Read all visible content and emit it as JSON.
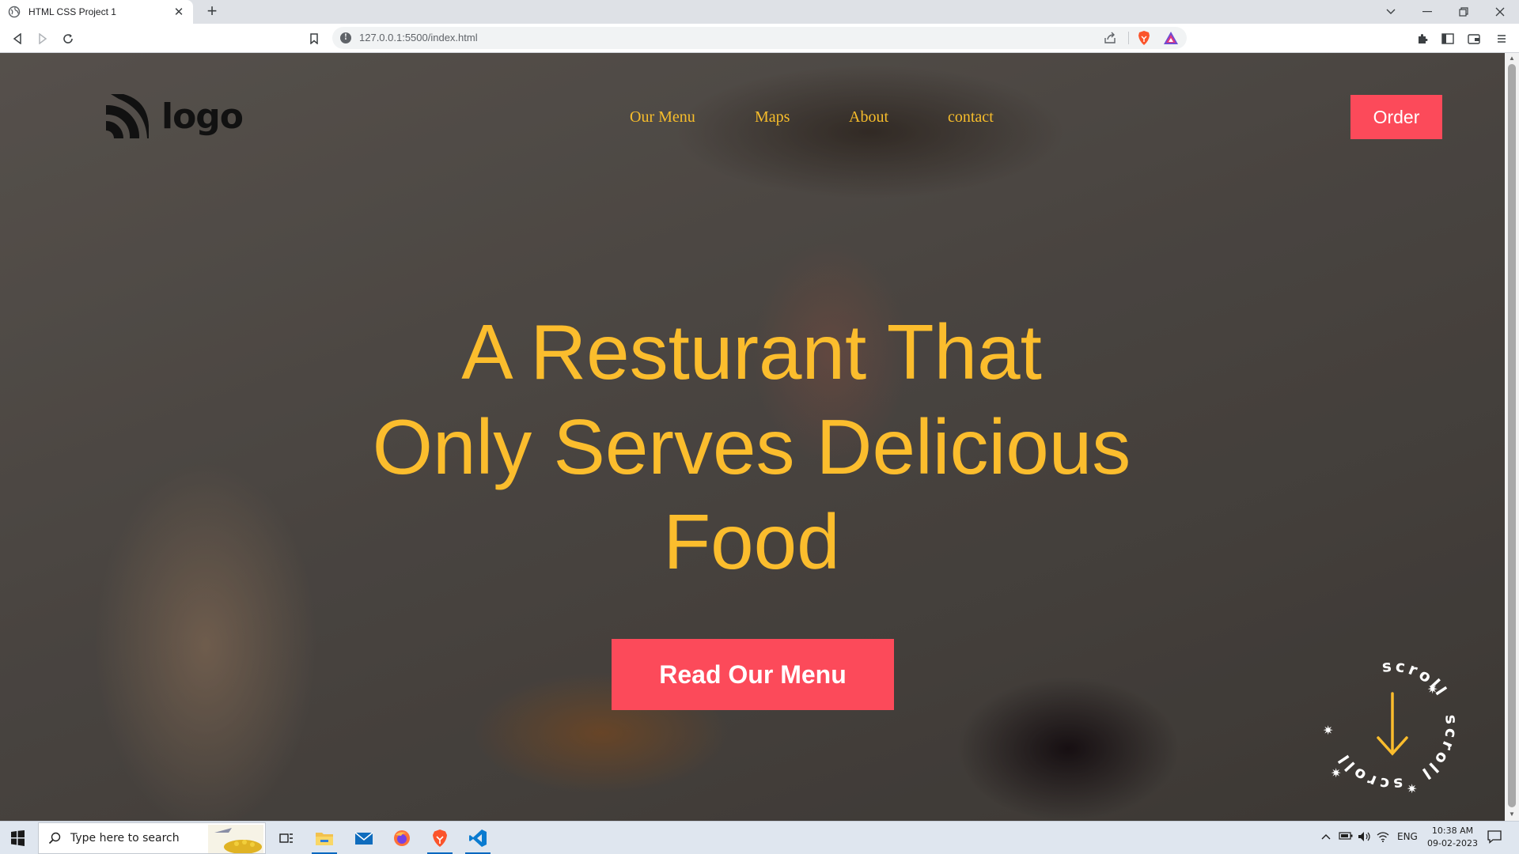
{
  "browser": {
    "tab_title": "HTML CSS Project 1",
    "tab_close": "✕",
    "new_tab": "+",
    "url": "127.0.0.1:5500/index.html"
  },
  "site": {
    "logo_text": "logo",
    "nav": [
      "Our Menu",
      "Maps",
      "About",
      "contact"
    ],
    "order_label": "Order",
    "hero_lines": [
      "A Resturant That",
      "Only Serves Delicious",
      "Food"
    ],
    "cta_label": "Read Our Menu",
    "scroll_badge_text": "scroll",
    "accent_color": "#fbbd2d",
    "button_color": "#fc4a5a"
  },
  "taskbar": {
    "search_placeholder": "Type here to search",
    "language": "ENG",
    "time": "10:38 AM",
    "date": "09-02-2023"
  }
}
